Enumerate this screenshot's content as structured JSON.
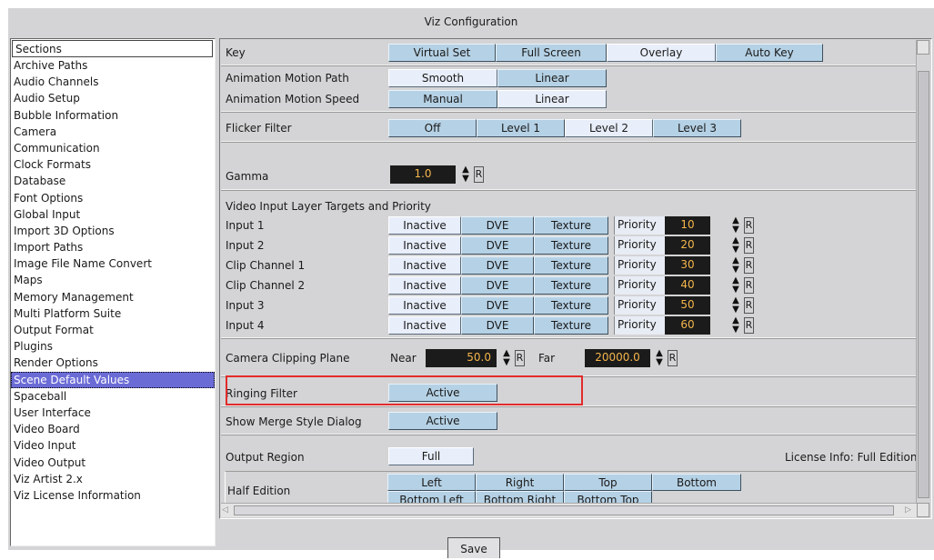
{
  "window": {
    "title": "Viz Configuration"
  },
  "sidebar": {
    "header": "Sections",
    "items": [
      "Archive Paths",
      "Audio Channels",
      "Audio Setup",
      "Bubble Information",
      "Camera",
      "Communication",
      "Clock Formats",
      "Database",
      "Font Options",
      "Global Input",
      "Import 3D Options",
      "Import Paths",
      "Image File Name Convert",
      "Maps",
      "Memory Management",
      "Multi Platform Suite",
      "Output Format",
      "Plugins",
      "Render Options",
      "Scene Default Values",
      "Spaceball",
      "User Interface",
      "Video Board",
      "Video Input",
      "Video Output",
      "Viz Artist 2.x",
      "Viz License Information"
    ],
    "selected_index": 19
  },
  "key": {
    "label": "Key",
    "options": [
      "Virtual Set",
      "Full Screen",
      "Overlay",
      "Auto Key"
    ],
    "selected": 2
  },
  "animation": {
    "path_label": "Animation Motion Path",
    "path_options": [
      "Smooth",
      "Linear"
    ],
    "path_selected": 0,
    "speed_label": "Animation Motion Speed",
    "speed_options": [
      "Manual",
      "Linear"
    ],
    "speed_selected": 1
  },
  "flicker": {
    "label": "Flicker Filter",
    "options": [
      "Off",
      "Level 1",
      "Level 2",
      "Level 3"
    ],
    "selected": 2
  },
  "gamma": {
    "label": "Gamma",
    "value": "1.0",
    "reset": "R"
  },
  "video_input": {
    "heading": "Video Input Layer Targets and Priority",
    "priority_label": "Priority",
    "rows": [
      {
        "name": "Input 1",
        "options": [
          "Inactive",
          "DVE",
          "Texture"
        ],
        "selected": 0,
        "priority": "10"
      },
      {
        "name": "Input 2",
        "options": [
          "Inactive",
          "DVE",
          "Texture"
        ],
        "selected": 0,
        "priority": "20"
      },
      {
        "name": "Clip Channel 1",
        "options": [
          "Inactive",
          "DVE",
          "Texture"
        ],
        "selected": 0,
        "priority": "30"
      },
      {
        "name": "Clip Channel 2",
        "options": [
          "Inactive",
          "DVE",
          "Texture"
        ],
        "selected": 0,
        "priority": "40"
      },
      {
        "name": "Input 3",
        "options": [
          "Inactive",
          "DVE",
          "Texture"
        ],
        "selected": 0,
        "priority": "50"
      },
      {
        "name": "Input 4",
        "options": [
          "Inactive",
          "DVE",
          "Texture"
        ],
        "selected": 0,
        "priority": "60"
      }
    ]
  },
  "clipping": {
    "label": "Camera Clipping Plane",
    "near_label": "Near",
    "near_value": "50.0",
    "far_label": "Far",
    "far_value": "20000.0",
    "reset": "R"
  },
  "ringing": {
    "label": "Ringing Filter",
    "value": "Active"
  },
  "merge": {
    "label": "Show Merge Style Dialog",
    "value": "Active"
  },
  "output_region": {
    "label": "Output Region",
    "value": "Full",
    "license_info": "License Info: Full Edition"
  },
  "half_edition": {
    "label": "Half Edition",
    "options_row1": [
      "Left",
      "Right",
      "Top",
      "Bottom"
    ],
    "options_row2": [
      "Bottom Left",
      "Bottom Right",
      "Bottom Top"
    ]
  },
  "footer": {
    "save_label": "Save"
  },
  "colors": {
    "button": "#b5d1e5",
    "selected_button": "#e8eefa",
    "sidebar_selection": "#6b6bd6",
    "highlight": "#e32b2b",
    "number_text": "#f5b64b"
  }
}
